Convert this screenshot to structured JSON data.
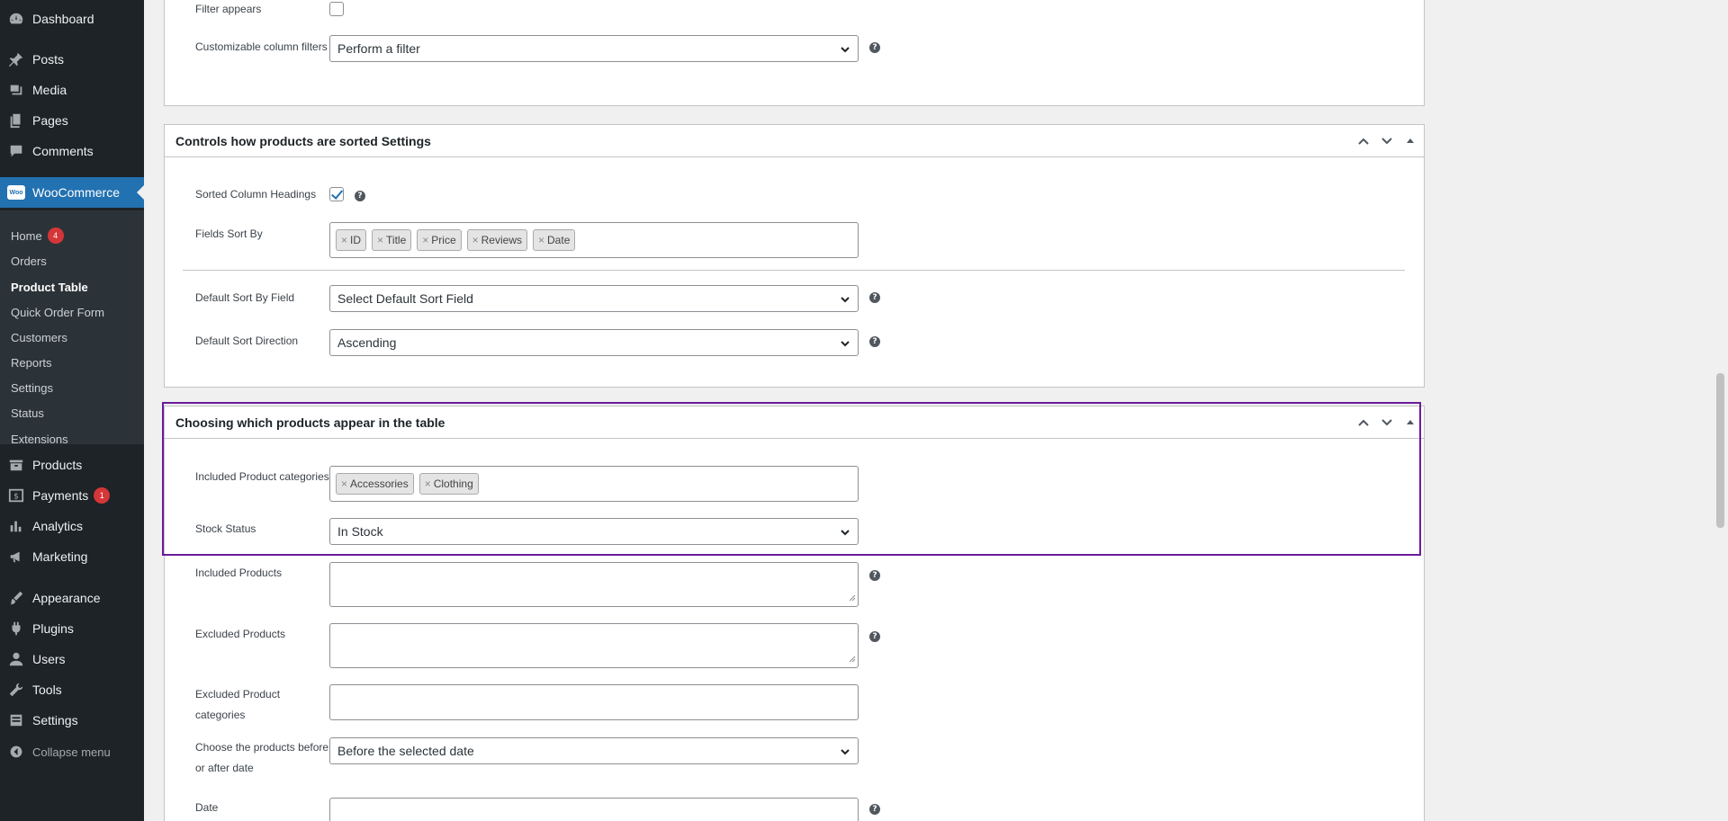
{
  "sidebar": {
    "menu": {
      "dashboard": "Dashboard",
      "posts": "Posts",
      "media": "Media",
      "pages": "Pages",
      "comments": "Comments",
      "woocommerce": "WooCommerce",
      "products": "Products",
      "payments": "Payments",
      "analytics": "Analytics",
      "marketing": "Marketing",
      "appearance": "Appearance",
      "plugins": "Plugins",
      "users": "Users",
      "tools": "Tools",
      "settings": "Settings",
      "collapse": "Collapse menu"
    },
    "woo_logo": "Woo",
    "badges": {
      "home": "4",
      "payments": "1"
    },
    "submenu": {
      "home": "Home",
      "orders": "Orders",
      "product_table": "Product Table",
      "quick_order_form": "Quick Order Form",
      "customers": "Customers",
      "reports": "Reports",
      "settings": "Settings",
      "status": "Status",
      "extensions": "Extensions"
    }
  },
  "panel_filters": {
    "filter_appears_label": "Filter appears",
    "custom_filters_label": "Customizable column filters",
    "custom_filters_value": "Perform a filter"
  },
  "panel_sort": {
    "title": "Controls how products are sorted Settings",
    "sorted_headings_label": "Sorted Column Headings",
    "fields_sort_by_label": "Fields Sort By",
    "fields_sort_by_tags": [
      "ID",
      "Title",
      "Price",
      "Reviews",
      "Date"
    ],
    "default_sort_field_label": "Default Sort By Field",
    "default_sort_field_value": "Select Default Sort Field",
    "default_sort_dir_label": "Default Sort Direction",
    "default_sort_dir_value": "Ascending"
  },
  "panel_choose": {
    "title": "Choosing which products appear in the table",
    "included_categories_label": "Included Product categories",
    "included_categories_tags": [
      "Accessories",
      "Clothing"
    ],
    "stock_status_label": "Stock Status",
    "stock_status_value": "In Stock",
    "included_products_label": "Included Products",
    "excluded_products_label": "Excluded Products",
    "excluded_categories_label": "Excluded Product categories",
    "before_after_label": "Choose the products before or after date",
    "before_after_value": "Before the selected date",
    "date_label": "Date"
  },
  "help_glyph": "?",
  "tag_remove_glyph": "×",
  "colors": {
    "sidebar_bg": "#1d2327",
    "active_menu": "#2271b1",
    "highlight_border": "#6a1b9a",
    "badge": "#d63638"
  }
}
